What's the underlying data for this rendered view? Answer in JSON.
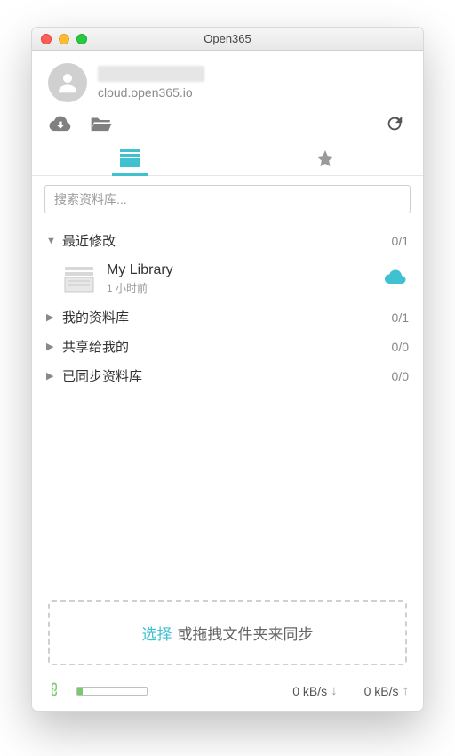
{
  "window": {
    "title": "Open365"
  },
  "account": {
    "server": "cloud.open365.io"
  },
  "search": {
    "placeholder": "搜索资料库..."
  },
  "sections": {
    "recent": {
      "label": "最近修改",
      "count": "0/1",
      "expanded": true
    },
    "mine": {
      "label": "我的资料库",
      "count": "0/1",
      "expanded": false
    },
    "shared": {
      "label": "共享给我的",
      "count": "0/0",
      "expanded": false
    },
    "synced": {
      "label": "已同步资料库",
      "count": "0/0",
      "expanded": false
    }
  },
  "library": {
    "title": "My Library",
    "time": "1 小时前"
  },
  "dropzone": {
    "choose": "选择",
    "rest": "或拖拽文件夹来同步"
  },
  "status": {
    "down": "0 kB/s",
    "up": "0 kB/s"
  }
}
